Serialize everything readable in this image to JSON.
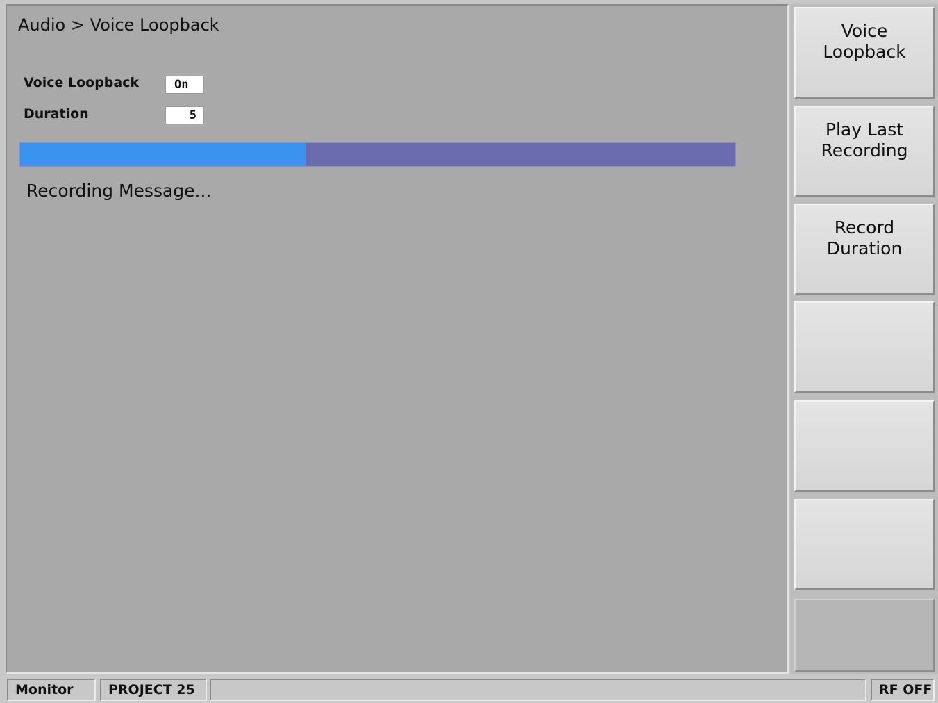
{
  "breadcrumb": "Audio > Voice Loopback",
  "settings": {
    "voice_loopback_label": "Voice Loopback",
    "voice_loopback_value": "On",
    "duration_label": "Duration",
    "duration_value": "5"
  },
  "progress": {
    "fraction": 0.4,
    "fill_color": "#3a93ee",
    "track_color": "#6b6bb0"
  },
  "status_message": "Recording Message...",
  "softkeys": [
    {
      "line1": "Voice",
      "line2": "Loopback"
    },
    {
      "line1": "Play Last",
      "line2": "Recording"
    },
    {
      "line1": "Record",
      "line2": "Duration"
    },
    {
      "line1": "",
      "line2": ""
    },
    {
      "line1": "",
      "line2": ""
    },
    {
      "line1": "",
      "line2": ""
    }
  ],
  "statusbar": {
    "mode": "Monitor",
    "system": "PROJECT 25",
    "message": "",
    "rf_state": "RF OFF"
  }
}
